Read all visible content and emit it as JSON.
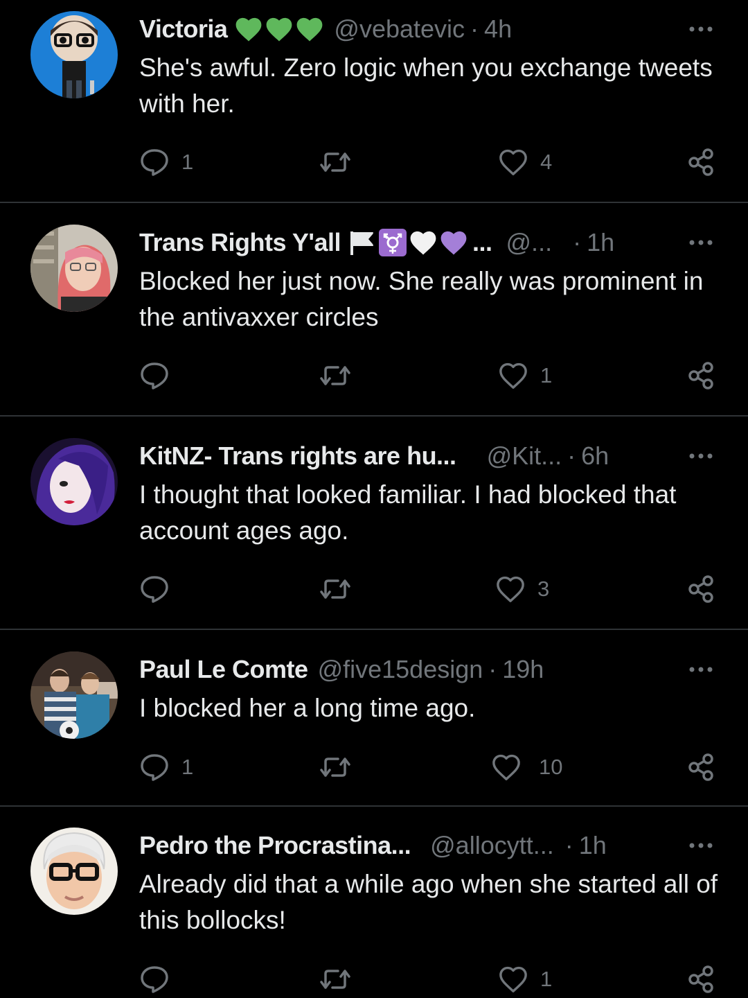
{
  "colors": {
    "background": "#000000",
    "text": "#e7e9ea",
    "secondary": "#71767b",
    "divider": "#2f3336",
    "green_heart": "#5fb85c",
    "purple_heart": "#a47fd8"
  },
  "tweets": [
    {
      "name": "Victoria",
      "badges": [
        "green-heart-icon",
        "green-heart-icon",
        "green-heart-icon"
      ],
      "handle": "@vebatevic",
      "separator": "·",
      "time": "4h",
      "text": "She's awful. Zero logic when you exchange tweets with her.",
      "reply_count": "1",
      "retweet_count": "",
      "like_count": "4"
    },
    {
      "name": "Trans Rights Y'all",
      "badges": [
        "white-flag-icon",
        "transgender-symbol-icon",
        "white-heart-icon",
        "purple-heart-icon"
      ],
      "ellipsis": "...",
      "handle": "@...",
      "separator": "·",
      "time": "1h",
      "text": "Blocked her just now. She really was prominent in the antivaxxer circles",
      "reply_count": "",
      "retweet_count": "",
      "like_count": "1"
    },
    {
      "name": "KitNZ- Trans rights are hu...",
      "badges": [],
      "handle": "@Kit...",
      "separator": "·",
      "time": "6h",
      "text": "I thought that looked familiar. I had blocked that account ages ago.",
      "reply_count": "",
      "retweet_count": "",
      "like_count": "3"
    },
    {
      "name": "Paul Le Comte",
      "badges": [],
      "handle": "@five15design",
      "separator": "·",
      "time": "19h",
      "text": "I blocked her a long time ago.",
      "reply_count": "1",
      "retweet_count": "",
      "like_count": "10"
    },
    {
      "name": "Pedro the Procrastina...",
      "badges": [],
      "handle": "@allocytt...",
      "separator": "·",
      "time": "1h",
      "text": "Already did that a while ago when she started all of this bollocks!",
      "reply_count": "",
      "retweet_count": "",
      "like_count": "1"
    }
  ]
}
